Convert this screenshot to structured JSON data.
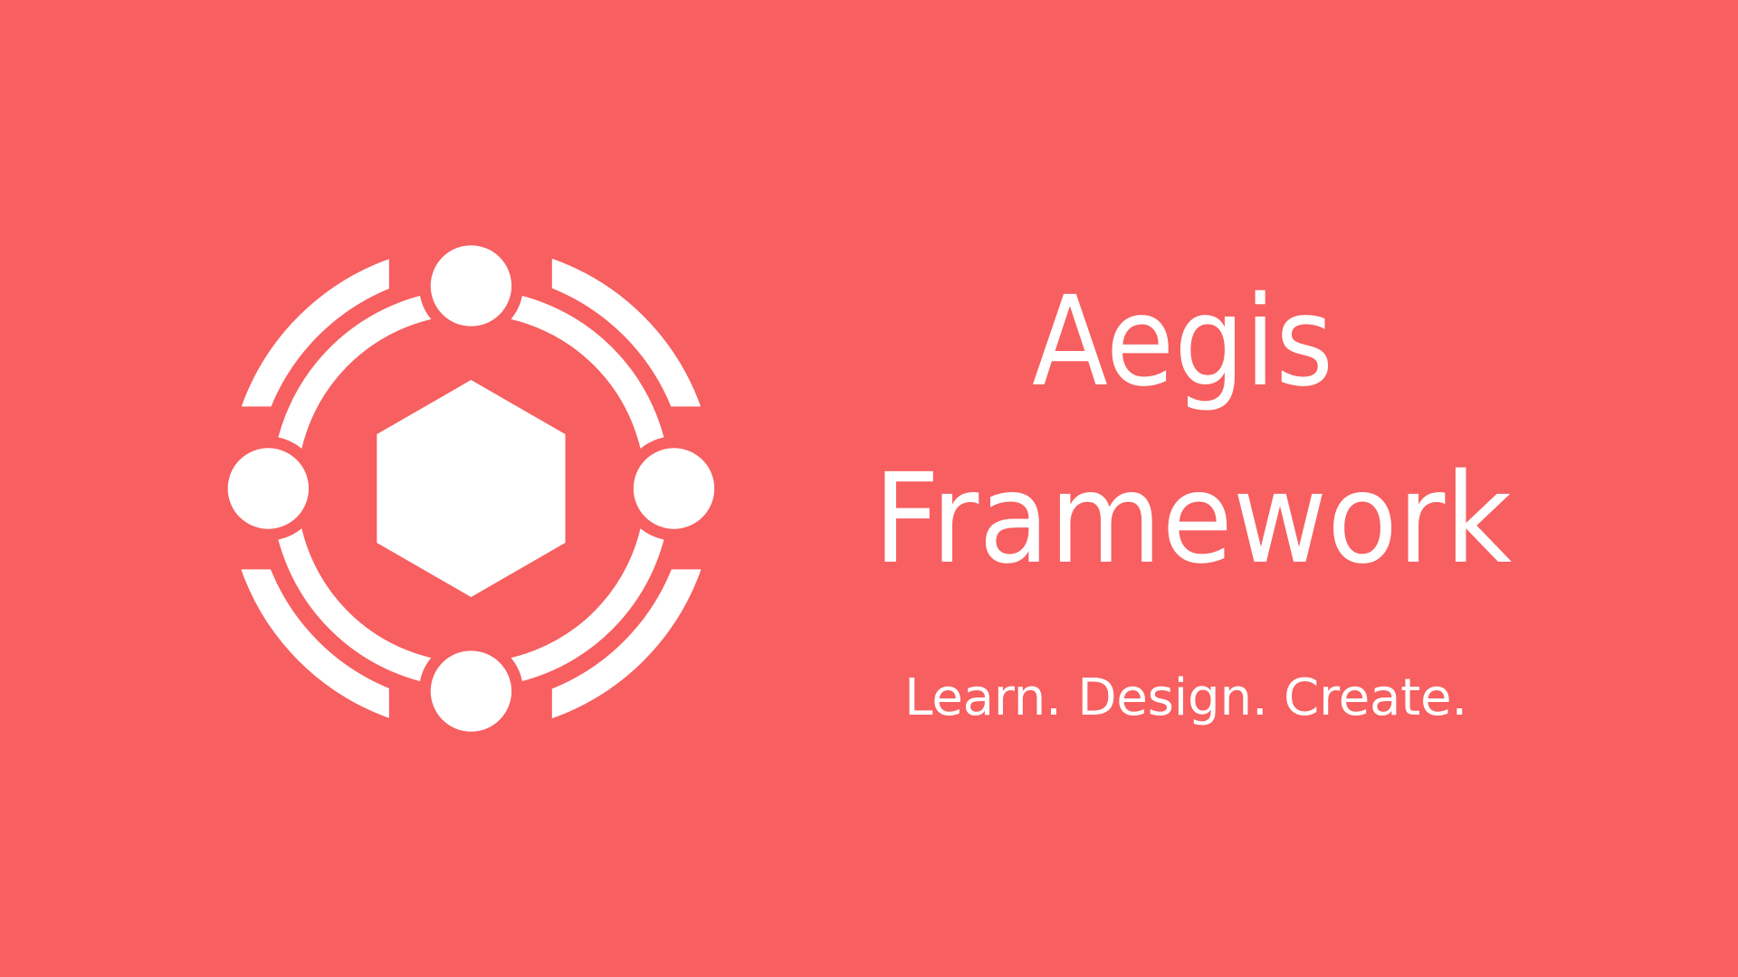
{
  "colors": {
    "background": "#F75F60",
    "foreground": "#FFFFFF"
  },
  "logo": {
    "icon": "hexagon-orbit-logo-icon"
  },
  "title": {
    "line1": "Aegis",
    "line2": "Framework"
  },
  "tagline": "Learn. Design. Create."
}
